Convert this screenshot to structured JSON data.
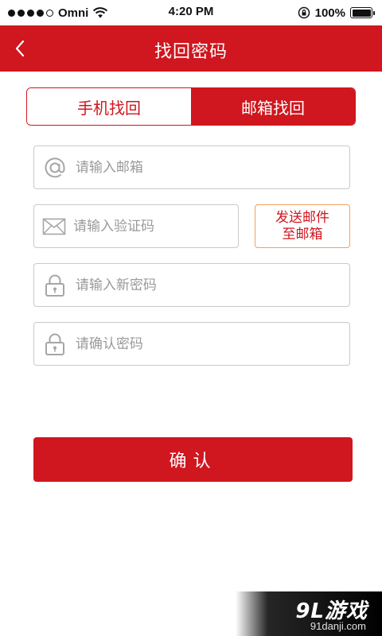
{
  "status_bar": {
    "carrier": "Omni",
    "time": "4:20 PM",
    "battery": "100%",
    "signal_bars": 4,
    "battery_level": 1.0
  },
  "nav": {
    "title": "找回密码",
    "back_icon": "chevron-left-icon"
  },
  "tabs": [
    {
      "label": "手机找回",
      "active": false
    },
    {
      "label": "邮箱找回",
      "active": true
    }
  ],
  "form": {
    "email_placeholder": "请输入邮箱",
    "code_placeholder": "请输入验证码",
    "send_button_label": "发送邮件\n至邮箱",
    "new_password_placeholder": "请输入新密码",
    "confirm_password_placeholder": "请确认密码",
    "icons": {
      "email": "at-icon",
      "code": "envelope-icon",
      "new_password": "lock-icon",
      "confirm_password": "lock-icon"
    }
  },
  "confirm_button_label": "确认",
  "watermark": {
    "logo": "9L游戏",
    "url": "91danji.com"
  },
  "colors": {
    "brand_red": "#d0161e",
    "send_border": "#f0a35a",
    "input_border": "#c9c9c9",
    "placeholder": "#9a9a9a"
  }
}
